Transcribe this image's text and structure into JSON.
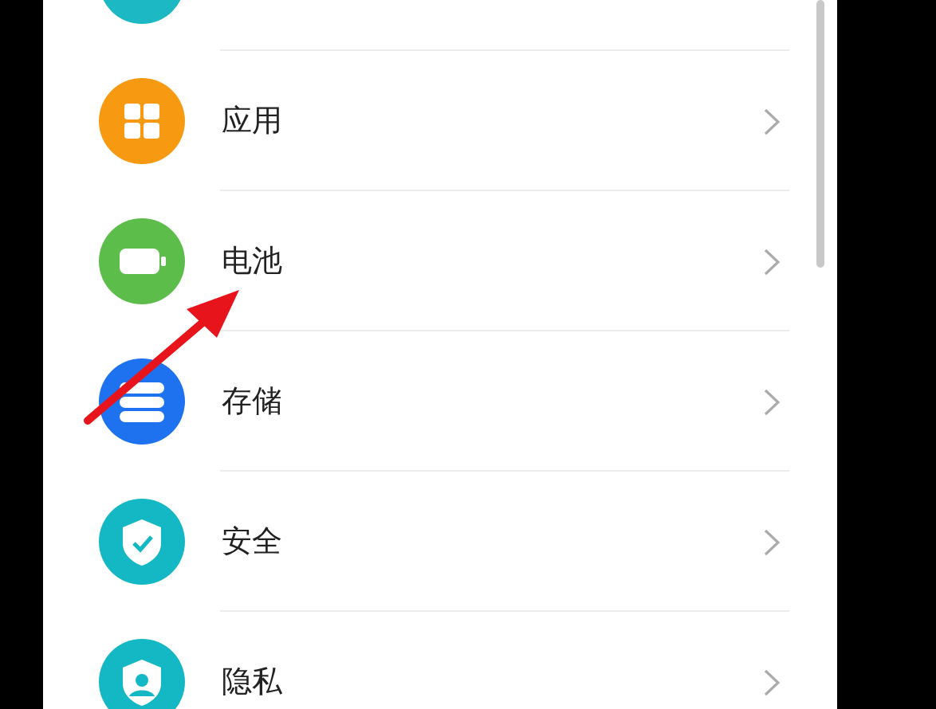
{
  "settings_list": [
    {
      "kind": "partial",
      "color": "#1cb8c4"
    },
    {
      "kind": "apps",
      "color": "#f79a12",
      "label": "应用"
    },
    {
      "kind": "battery",
      "color": "#5cbd4a",
      "label": "电池"
    },
    {
      "kind": "storage",
      "color": "#1e72f0",
      "label": "存储"
    },
    {
      "kind": "security",
      "color": "#14b8c4",
      "label": "安全"
    },
    {
      "kind": "privacy",
      "color": "#14b8c4",
      "label": "隐私"
    }
  ],
  "annotation": {
    "kind": "arrow"
  }
}
